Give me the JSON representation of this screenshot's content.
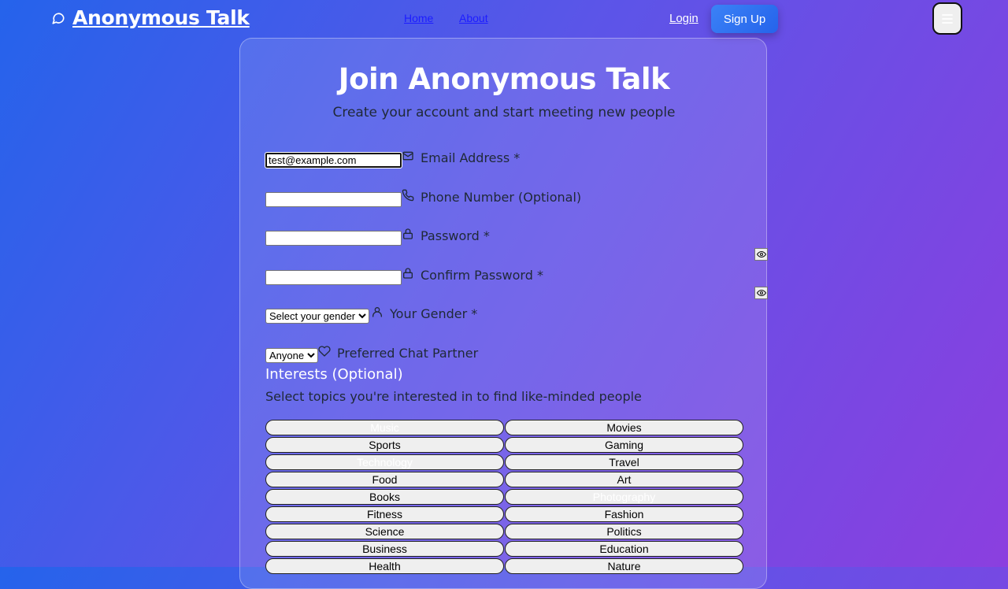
{
  "nav": {
    "brand": "Anonymous Talk",
    "links": [
      {
        "label": "Home"
      },
      {
        "label": "About"
      }
    ],
    "login": "Login",
    "signup": "Sign Up"
  },
  "form": {
    "title": "Join Anonymous Talk",
    "subtitle": "Create your account and start meeting new people",
    "email": {
      "label": "Email Address *",
      "value": "test@example.com"
    },
    "phone": {
      "label": "Phone Number (Optional)",
      "value": ""
    },
    "password": {
      "label": "Password *",
      "value": ""
    },
    "confirm_password": {
      "label": "Confirm Password *",
      "value": ""
    },
    "gender": {
      "label": "Your Gender *",
      "selected": "Select your gender"
    },
    "preferred": {
      "label": "Preferred Chat Partner",
      "selected": "Anyone"
    },
    "interests": {
      "title": "Interests (Optional)",
      "subtitle": "Select topics you're interested in to find like-minded people",
      "items": [
        {
          "label": "Music",
          "selected": true
        },
        {
          "label": "Movies",
          "selected": false
        },
        {
          "label": "Sports",
          "selected": false
        },
        {
          "label": "Gaming",
          "selected": false
        },
        {
          "label": "Technology",
          "selected": true
        },
        {
          "label": "Travel",
          "selected": false
        },
        {
          "label": "Food",
          "selected": false
        },
        {
          "label": "Art",
          "selected": false
        },
        {
          "label": "Books",
          "selected": false
        },
        {
          "label": "Photography",
          "selected": true
        },
        {
          "label": "Fitness",
          "selected": false
        },
        {
          "label": "Fashion",
          "selected": false
        },
        {
          "label": "Science",
          "selected": false
        },
        {
          "label": "Politics",
          "selected": false
        },
        {
          "label": "Business",
          "selected": false
        },
        {
          "label": "Education",
          "selected": false
        },
        {
          "label": "Health",
          "selected": false
        },
        {
          "label": "Nature",
          "selected": false
        }
      ]
    }
  },
  "icons": {
    "brand": "chat-bubble-icon",
    "menu": "hamburger-menu-icon",
    "email": "envelope-icon",
    "phone": "phone-icon",
    "password": "lock-icon",
    "toggle": "eye-icon",
    "gender": "user-icon",
    "preferred": "heart-icon"
  },
  "colors": {
    "gradient_start": "#2563eb",
    "gradient_end": "#8b3fdf",
    "signup_button": "#2f73f0"
  }
}
